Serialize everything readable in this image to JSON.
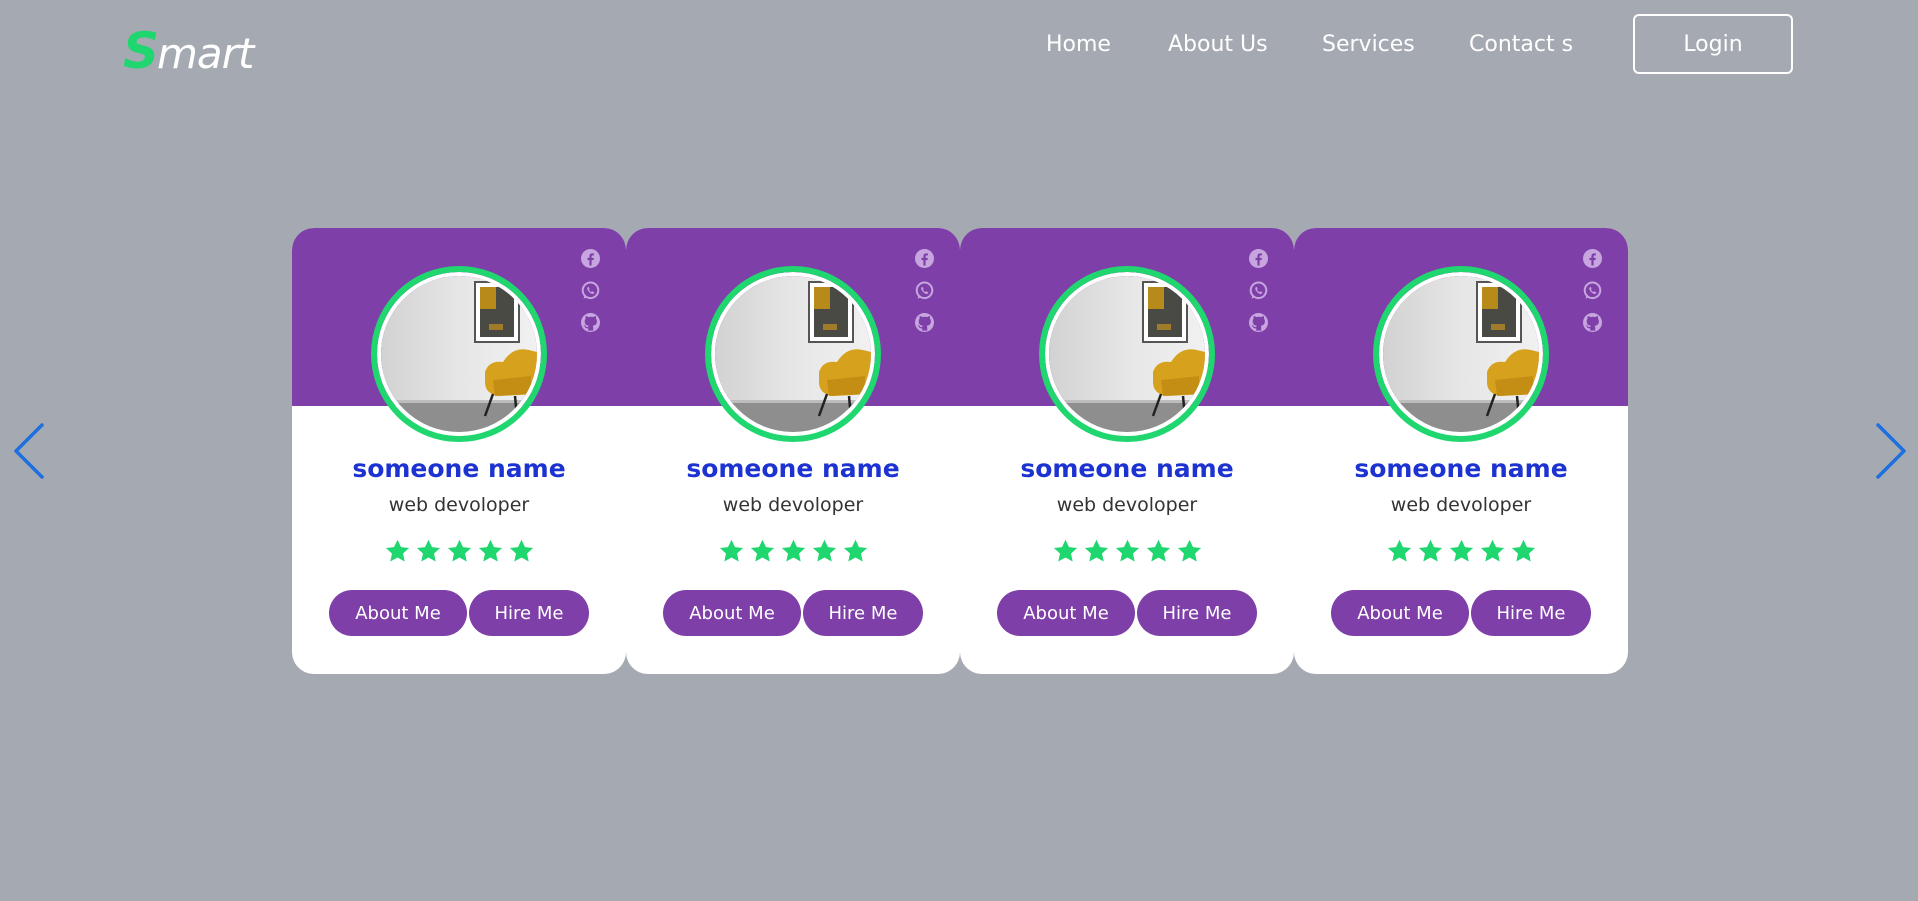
{
  "logo": {
    "first_letter": "S",
    "rest": "mart"
  },
  "nav": {
    "items": [
      "Home",
      "About Us",
      "Services",
      "Contact s"
    ],
    "login_label": "Login"
  },
  "carousel": {
    "prev_icon": "chevron-left-icon",
    "next_icon": "chevron-right-icon"
  },
  "cards": [
    {
      "name": "someone name",
      "role": "web devoloper",
      "rating": 5,
      "about_label": "About Me",
      "hire_label": "Hire Me"
    },
    {
      "name": "someone name",
      "role": "web devoloper",
      "rating": 5,
      "about_label": "About Me",
      "hire_label": "Hire Me"
    },
    {
      "name": "someone name",
      "role": "web devoloper",
      "rating": 5,
      "about_label": "About Me",
      "hire_label": "Hire Me"
    },
    {
      "name": "someone name",
      "role": "web devoloper",
      "rating": 5,
      "about_label": "About Me",
      "hire_label": "Hire Me"
    }
  ],
  "social_icons": [
    "facebook-icon",
    "whatsapp-icon",
    "github-icon"
  ],
  "colors": {
    "background": "#a5aab2",
    "accent_purple": "#7e3fa8",
    "accent_green": "#1fd66f",
    "name_blue": "#1d33d1",
    "arrow_blue": "#1e6fe0"
  }
}
